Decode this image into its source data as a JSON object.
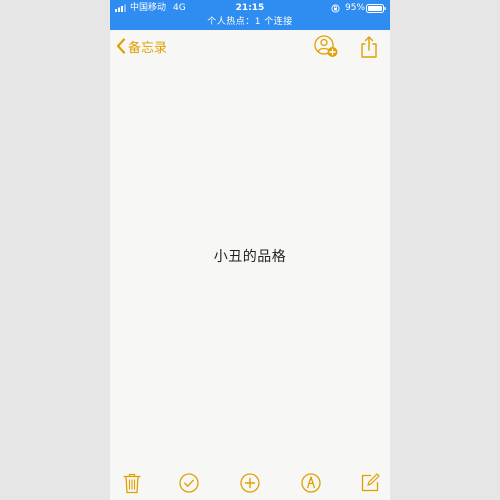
{
  "status_bar": {
    "carrier": "中国移动",
    "network": "4G",
    "time": "21:15",
    "battery_percent": "95%",
    "hotspot_text": "个人热点：1 个连接",
    "background_color": "#2f8cf0"
  },
  "nav": {
    "back_label": "备忘录",
    "back_icon": "chevron-left-icon",
    "collaborate_icon": "add-person-icon",
    "share_icon": "share-icon",
    "accent_color": "#e0a100"
  },
  "note": {
    "text": "小丑的品格"
  },
  "toolbar": {
    "items": [
      {
        "icon": "trash-icon"
      },
      {
        "icon": "checklist-icon"
      },
      {
        "icon": "add-icon"
      },
      {
        "icon": "markup-pen-icon"
      },
      {
        "icon": "compose-icon"
      }
    ]
  }
}
